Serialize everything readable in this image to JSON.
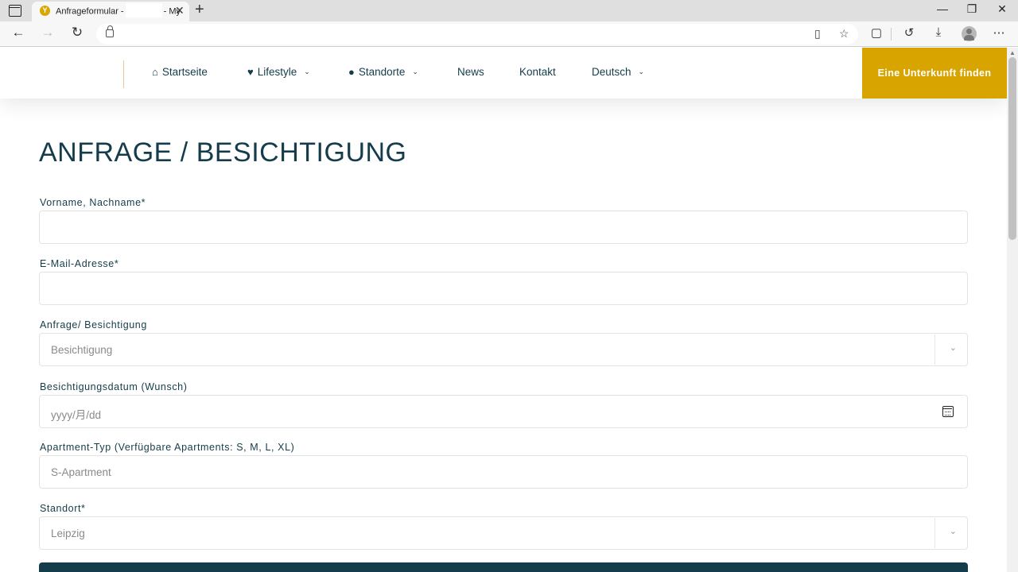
{
  "browser": {
    "tab_title_prefix": "Anfrageformular -",
    "tab_title_suffix": "- My",
    "favicon_letter": "Y",
    "close_glyph": "✕",
    "new_tab_glyph": "+",
    "window_controls": {
      "minimize": "—",
      "maximize": "❐",
      "close": "✕"
    },
    "nav": {
      "back": "←",
      "forward": "→",
      "reload": "↻"
    },
    "toolbar_icons": {
      "reader": "▯",
      "favorites": "☆",
      "collections": "▢",
      "history": "↺",
      "downloads": "⤓",
      "more": "⋯"
    }
  },
  "header": {
    "menu": [
      {
        "label": "Startseite",
        "icon": "home-icon",
        "glyph": "⌂",
        "has_dropdown": false
      },
      {
        "label": "Lifestyle",
        "icon": "heart-icon",
        "glyph": "♥",
        "has_dropdown": true
      },
      {
        "label": "Standorte",
        "icon": "globe-icon",
        "glyph": "●",
        "has_dropdown": true
      },
      {
        "label": "News",
        "has_dropdown": false
      },
      {
        "label": "Kontakt",
        "has_dropdown": false
      },
      {
        "label": "Deutsch",
        "has_dropdown": true
      }
    ],
    "chevron_glyph": "⌄",
    "cta_label": "Eine Unterkunft finden",
    "accent_color": "#d8a400",
    "text_color": "#143c4a"
  },
  "form": {
    "title": "ANFRAGE / BESICHTIGUNG",
    "fields": [
      {
        "label": "Vorname, Nachname*",
        "value": "",
        "type": "text"
      },
      {
        "label": "E-Mail-Adresse*",
        "value": "",
        "type": "email"
      },
      {
        "label": "Anfrage/ Besichtigung",
        "value": "Besichtigung",
        "type": "select"
      },
      {
        "label": "Besichtigungsdatum (Wunsch)",
        "value": "yyyy/月/dd",
        "type": "date"
      },
      {
        "label": "Apartment-Typ (Verfügbare Apartments: S, M, L, XL)",
        "value": "S-Apartment",
        "type": "text"
      },
      {
        "label": "Standort*",
        "value": "Leipzig",
        "type": "select"
      }
    ],
    "select_chevron": "⌄"
  }
}
